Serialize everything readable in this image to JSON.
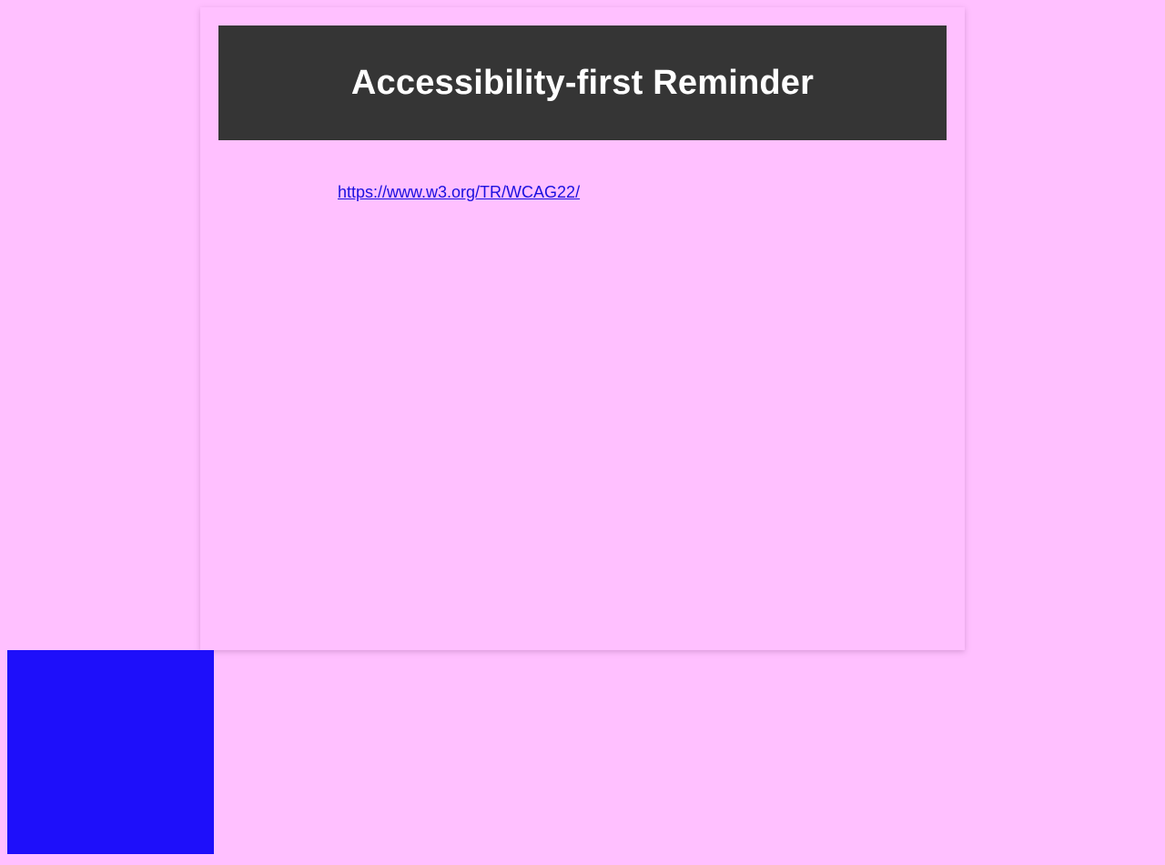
{
  "reminder": {
    "title": "Accessibility-first Reminder",
    "link_text": "https://www.w3.org/TR/WCAG22/",
    "link_href": "https://www.w3.org/TR/WCAG22/"
  },
  "colors": {
    "page_background": "#ffc0ff",
    "banner_background": "#353535",
    "banner_text": "#ffffff",
    "link": "#1a10e0",
    "block": "#1e0ffa"
  }
}
